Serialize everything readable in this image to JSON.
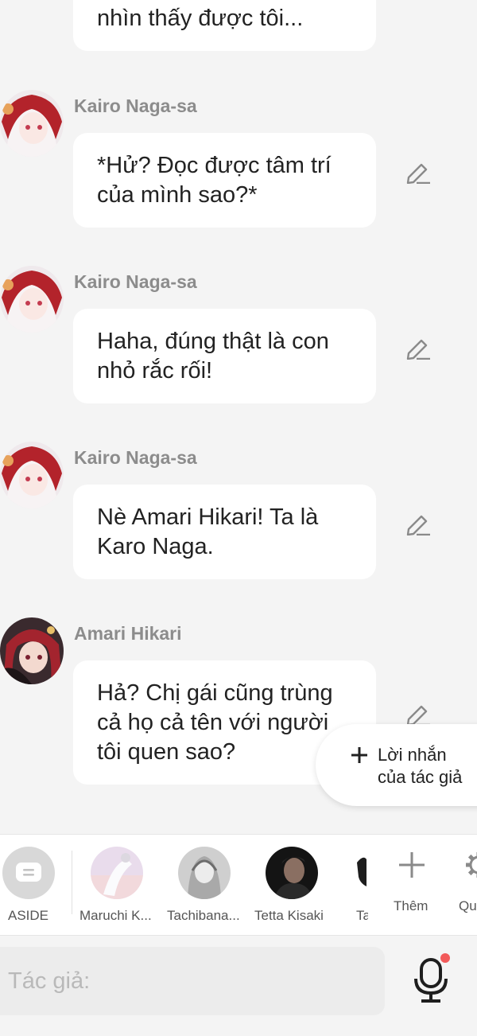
{
  "messages": [
    {
      "sender": "",
      "text": "nhìn thấy được tôi...",
      "editable": false
    },
    {
      "sender": "Kairo Naga-sa",
      "text": "*Hử? Đọc được tâm trí\ncủa mình sao?*",
      "editable": true
    },
    {
      "sender": "Kairo Naga-sa",
      "text": "Haha, đúng thật là con\nnhỏ rắc rối!",
      "editable": true
    },
    {
      "sender": "Kairo Naga-sa",
      "text": "Nè Amari Hikari! Ta là\nKaro Naga.",
      "editable": true
    },
    {
      "sender": "Amari Hikari",
      "text": "Hả? Chị gái cũng trùng\ncả họ cả tên với người\ntôi quen sao?",
      "editable": true
    }
  ],
  "author_note": {
    "label": "Lời nhắn\ncủa tác giả",
    "icon": "plus-icon"
  },
  "characters": [
    {
      "label": "ASIDE",
      "icon": "aside-icon"
    },
    {
      "label": "Maruchi K..."
    },
    {
      "label": "Tachibana..."
    },
    {
      "label": "Tetta Kisaki"
    },
    {
      "label": "Ta"
    },
    {
      "label": "Thêm",
      "icon": "plus-icon"
    },
    {
      "label": "Qu",
      "icon": "gear-icon"
    }
  ],
  "input": {
    "placeholder": "Tác giả:",
    "value": ""
  },
  "colors": {
    "background": "#f4f4f4",
    "bubble": "#ffffff",
    "sender": "#8c8c8c",
    "notification": "#f25a5a"
  }
}
